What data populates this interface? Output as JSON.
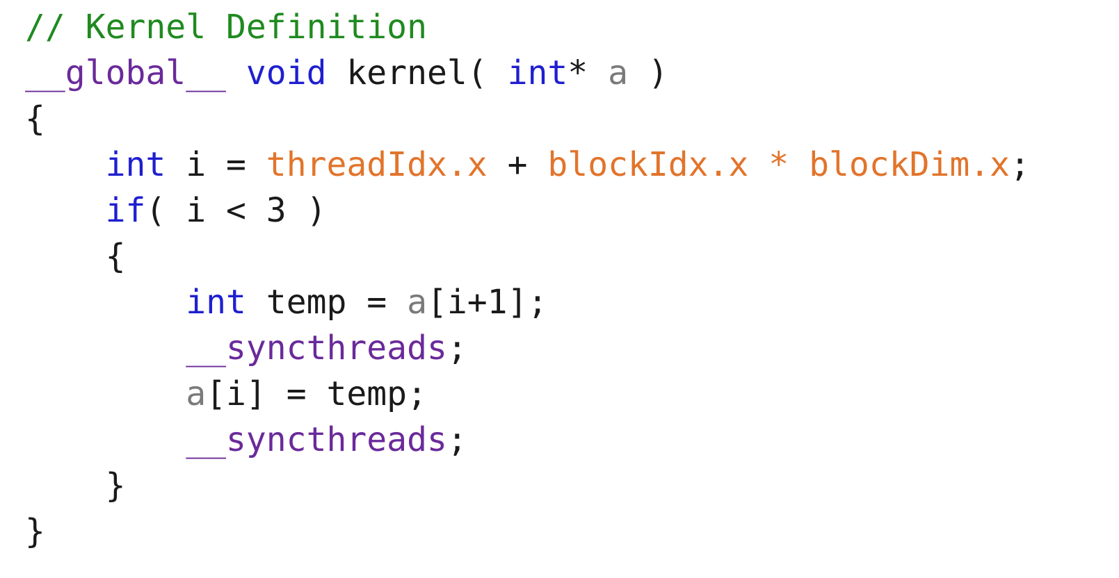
{
  "colors": {
    "background": "#ffffff",
    "comment": "#1f8a1f",
    "keyword": "#1f1fd0",
    "special": "#6a2a9a",
    "builtin": "#e2742b",
    "param": "#7a7a7a",
    "plain": "#1a1a1a"
  },
  "code": {
    "lines": [
      [
        {
          "text": "// Kernel Definition",
          "kind": "comment"
        }
      ],
      [
        {
          "text": "__global__",
          "kind": "special"
        },
        {
          "text": " ",
          "kind": "plain"
        },
        {
          "text": "void",
          "kind": "keyword"
        },
        {
          "text": " kernel( ",
          "kind": "plain"
        },
        {
          "text": "int",
          "kind": "keyword"
        },
        {
          "text": "* ",
          "kind": "plain"
        },
        {
          "text": "a",
          "kind": "param"
        },
        {
          "text": " )",
          "kind": "plain"
        }
      ],
      [
        {
          "text": "{",
          "kind": "plain"
        }
      ],
      [
        {
          "text": "    ",
          "kind": "plain"
        },
        {
          "text": "int",
          "kind": "keyword"
        },
        {
          "text": " i = ",
          "kind": "plain"
        },
        {
          "text": "threadIdx.x",
          "kind": "builtin"
        },
        {
          "text": " + ",
          "kind": "plain"
        },
        {
          "text": "blockIdx.x",
          "kind": "builtin"
        },
        {
          "text": " ",
          "kind": "plain"
        },
        {
          "text": "*",
          "kind": "builtin"
        },
        {
          "text": " ",
          "kind": "plain"
        },
        {
          "text": "blockDim.x",
          "kind": "builtin"
        },
        {
          "text": ";",
          "kind": "plain"
        }
      ],
      [
        {
          "text": "    ",
          "kind": "plain"
        },
        {
          "text": "if",
          "kind": "keyword"
        },
        {
          "text": "( i < 3 )",
          "kind": "plain"
        }
      ],
      [
        {
          "text": "    {",
          "kind": "plain"
        }
      ],
      [
        {
          "text": "        ",
          "kind": "plain"
        },
        {
          "text": "int",
          "kind": "keyword"
        },
        {
          "text": " temp = ",
          "kind": "plain"
        },
        {
          "text": "a",
          "kind": "param"
        },
        {
          "text": "[i+1];",
          "kind": "plain"
        }
      ],
      [
        {
          "text": "        ",
          "kind": "plain"
        },
        {
          "text": "__syncthreads",
          "kind": "special"
        },
        {
          "text": ";",
          "kind": "plain"
        }
      ],
      [
        {
          "text": "        ",
          "kind": "plain"
        },
        {
          "text": "a",
          "kind": "param"
        },
        {
          "text": "[i] = temp;",
          "kind": "plain"
        }
      ],
      [
        {
          "text": "        ",
          "kind": "plain"
        },
        {
          "text": "__syncthreads",
          "kind": "special"
        },
        {
          "text": ";",
          "kind": "plain"
        }
      ],
      [
        {
          "text": "    }",
          "kind": "plain"
        }
      ],
      [
        {
          "text": "}",
          "kind": "plain"
        }
      ]
    ]
  }
}
